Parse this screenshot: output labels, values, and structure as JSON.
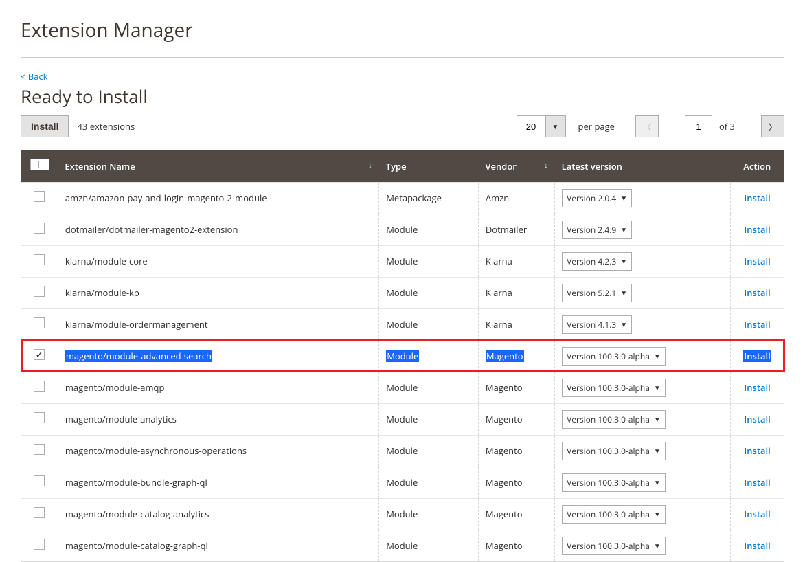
{
  "page_title": "Extension Manager",
  "back_link": "< Back",
  "section_title": "Ready to Install",
  "install_button": "Install",
  "extensions_count": "43 extensions",
  "pagination": {
    "page_size": "20",
    "per_page_label": "per page",
    "current_page": "1",
    "of_label": "of 3"
  },
  "columns": {
    "name": "Extension Name",
    "type": "Type",
    "vendor": "Vendor",
    "version": "Latest version",
    "action": "Action"
  },
  "action_label": "Install",
  "rows": [
    {
      "name": "amzn/amazon-pay-and-login-magento-2-module",
      "type": "Metapackage",
      "vendor": "Amzn",
      "version": "Version 2.0.4",
      "checked": false,
      "highlight": false
    },
    {
      "name": "dotmailer/dotmailer-magento2-extension",
      "type": "Module",
      "vendor": "Dotmailer",
      "version": "Version 2.4.9",
      "checked": false,
      "highlight": false
    },
    {
      "name": "klarna/module-core",
      "type": "Module",
      "vendor": "Klarna",
      "version": "Version 4.2.3",
      "checked": false,
      "highlight": false
    },
    {
      "name": "klarna/module-kp",
      "type": "Module",
      "vendor": "Klarna",
      "version": "Version 5.2.1",
      "checked": false,
      "highlight": false
    },
    {
      "name": "klarna/module-ordermanagement",
      "type": "Module",
      "vendor": "Klarna",
      "version": "Version 4.1.3",
      "checked": false,
      "highlight": false
    },
    {
      "name": "magento/module-advanced-search",
      "type": "Module",
      "vendor": "Magento",
      "version": "Version 100.3.0-alpha",
      "checked": true,
      "highlight": true
    },
    {
      "name": "magento/module-amqp",
      "type": "Module",
      "vendor": "Magento",
      "version": "Version 100.3.0-alpha",
      "checked": false,
      "highlight": false
    },
    {
      "name": "magento/module-analytics",
      "type": "Module",
      "vendor": "Magento",
      "version": "Version 100.3.0-alpha",
      "checked": false,
      "highlight": false
    },
    {
      "name": "magento/module-asynchronous-operations",
      "type": "Module",
      "vendor": "Magento",
      "version": "Version 100.3.0-alpha",
      "checked": false,
      "highlight": false
    },
    {
      "name": "magento/module-bundle-graph-ql",
      "type": "Module",
      "vendor": "Magento",
      "version": "Version 100.3.0-alpha",
      "checked": false,
      "highlight": false
    },
    {
      "name": "magento/module-catalog-analytics",
      "type": "Module",
      "vendor": "Magento",
      "version": "Version 100.3.0-alpha",
      "checked": false,
      "highlight": false
    },
    {
      "name": "magento/module-catalog-graph-ql",
      "type": "Module",
      "vendor": "Magento",
      "version": "Version 100.3.0-alpha",
      "checked": false,
      "highlight": false
    }
  ]
}
